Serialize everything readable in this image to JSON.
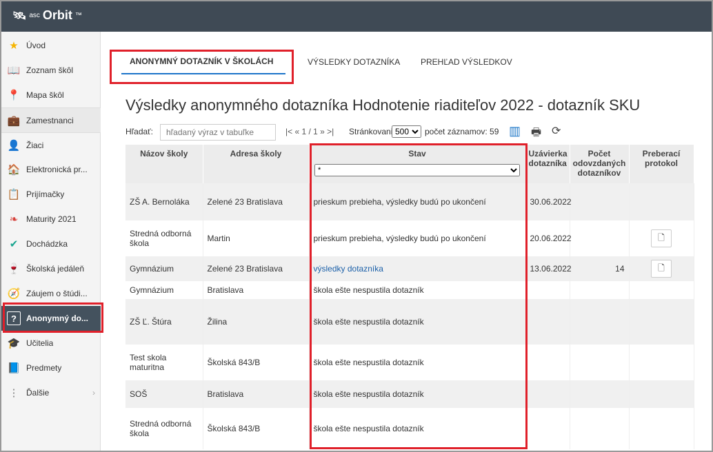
{
  "app": {
    "logo_prefix": "asc",
    "logo_name": "Orbit",
    "logo_tm": "™"
  },
  "sidebar": {
    "items": [
      {
        "label": "Úvod",
        "icon": "star-icon"
      },
      {
        "label": "Zoznam škôl",
        "icon": "book-icon"
      },
      {
        "label": "Mapa škôl",
        "icon": "map-pin-icon"
      },
      {
        "label": "Zamestnanci",
        "icon": "briefcase-icon"
      },
      {
        "label": "Žiaci",
        "icon": "student-icon"
      },
      {
        "label": "Elektronická pr...",
        "icon": "home-gear-icon"
      },
      {
        "label": "Prijímačky",
        "icon": "clipboard-icon"
      },
      {
        "label": "Maturity 2021",
        "icon": "leaf-icon"
      },
      {
        "label": "Dochádzka",
        "icon": "check-badge-icon"
      },
      {
        "label": "Školská jedáleň",
        "icon": "cup-icon"
      },
      {
        "label": "Záujem o štúdi...",
        "icon": "compass-icon"
      },
      {
        "label": "Anonymný do...",
        "icon": "question-icon"
      },
      {
        "label": "Učitelia",
        "icon": "graduation-icon"
      },
      {
        "label": "Predmety",
        "icon": "notebook-icon"
      },
      {
        "label": "Ďalšie",
        "icon": "more-icon"
      }
    ]
  },
  "tabs": [
    {
      "label": "ANONYMNÝ DOTAZNÍK V ŠKOLÁCH"
    },
    {
      "label": "VÝSLEDKY DOTAZNÍKA"
    },
    {
      "label": "PREHĽAD VÝSLEDKOV"
    }
  ],
  "page_title": "Výsledky anonymného dotazníka Hodnotenie riaditeľov 2022 - dotazník SKU",
  "toolbar": {
    "search_label": "Hľadať:",
    "search_placeholder": "hľadaný výraz v tabuľke",
    "pager_text": "|< « 1 / 1 » >|",
    "paging_label": "Stránkovanie:",
    "paging_value": "500",
    "count_label": "počet záznamov: 59"
  },
  "table": {
    "headers": [
      "Názov školy",
      "Adresa školy",
      "Stav",
      "Uzávierka dotazníka",
      "Počet odovzdaných dotazníkov",
      "Preberací protokol"
    ],
    "status_filter": "*",
    "rows": [
      {
        "name": "ZŠ A. Bernoláka",
        "address": "Zelené 23 Bratislava",
        "status": "prieskum prebieha, výsledky budú po ukončení",
        "deadline": "30.06.2022",
        "count": "",
        "protocol": false,
        "link": false
      },
      {
        "name": "Stredná odborná škola",
        "address": "Martin",
        "status": "prieskum prebieha, výsledky budú po ukončení",
        "deadline": "20.06.2022",
        "count": "",
        "protocol": true,
        "link": false
      },
      {
        "name": "Gymnázium",
        "address": "Zelené 23 Bratislava",
        "status": "výsledky dotazníka",
        "deadline": "13.06.2022",
        "count": "14",
        "protocol": true,
        "link": true
      },
      {
        "name": "Gymnázium",
        "address": "Bratislava",
        "status": "škola ešte nespustila dotazník",
        "deadline": "",
        "count": "",
        "protocol": false,
        "link": false
      },
      {
        "name": "ZŠ Ľ. Štúra",
        "address": "Žilina",
        "status": "škola ešte nespustila dotazník",
        "deadline": "",
        "count": "",
        "protocol": false,
        "link": false
      },
      {
        "name": "Test skola maturitna",
        "address": "Školská 843/B",
        "status": "škola ešte nespustila dotazník",
        "deadline": "",
        "count": "",
        "protocol": false,
        "link": false
      },
      {
        "name": "SOŠ",
        "address": "Bratislava",
        "status": "škola ešte nespustila dotazník",
        "deadline": "",
        "count": "",
        "protocol": false,
        "link": false
      },
      {
        "name": "Stredná odborná škola",
        "address": "Školská 843/B",
        "status": "škola ešte nespustila dotazník",
        "deadline": "",
        "count": "",
        "protocol": false,
        "link": false
      }
    ]
  },
  "colors": {
    "topbar": "#3f4a55",
    "active_item": "#44525e",
    "highlight": "#e0202a",
    "link": "#1a5fa8"
  }
}
